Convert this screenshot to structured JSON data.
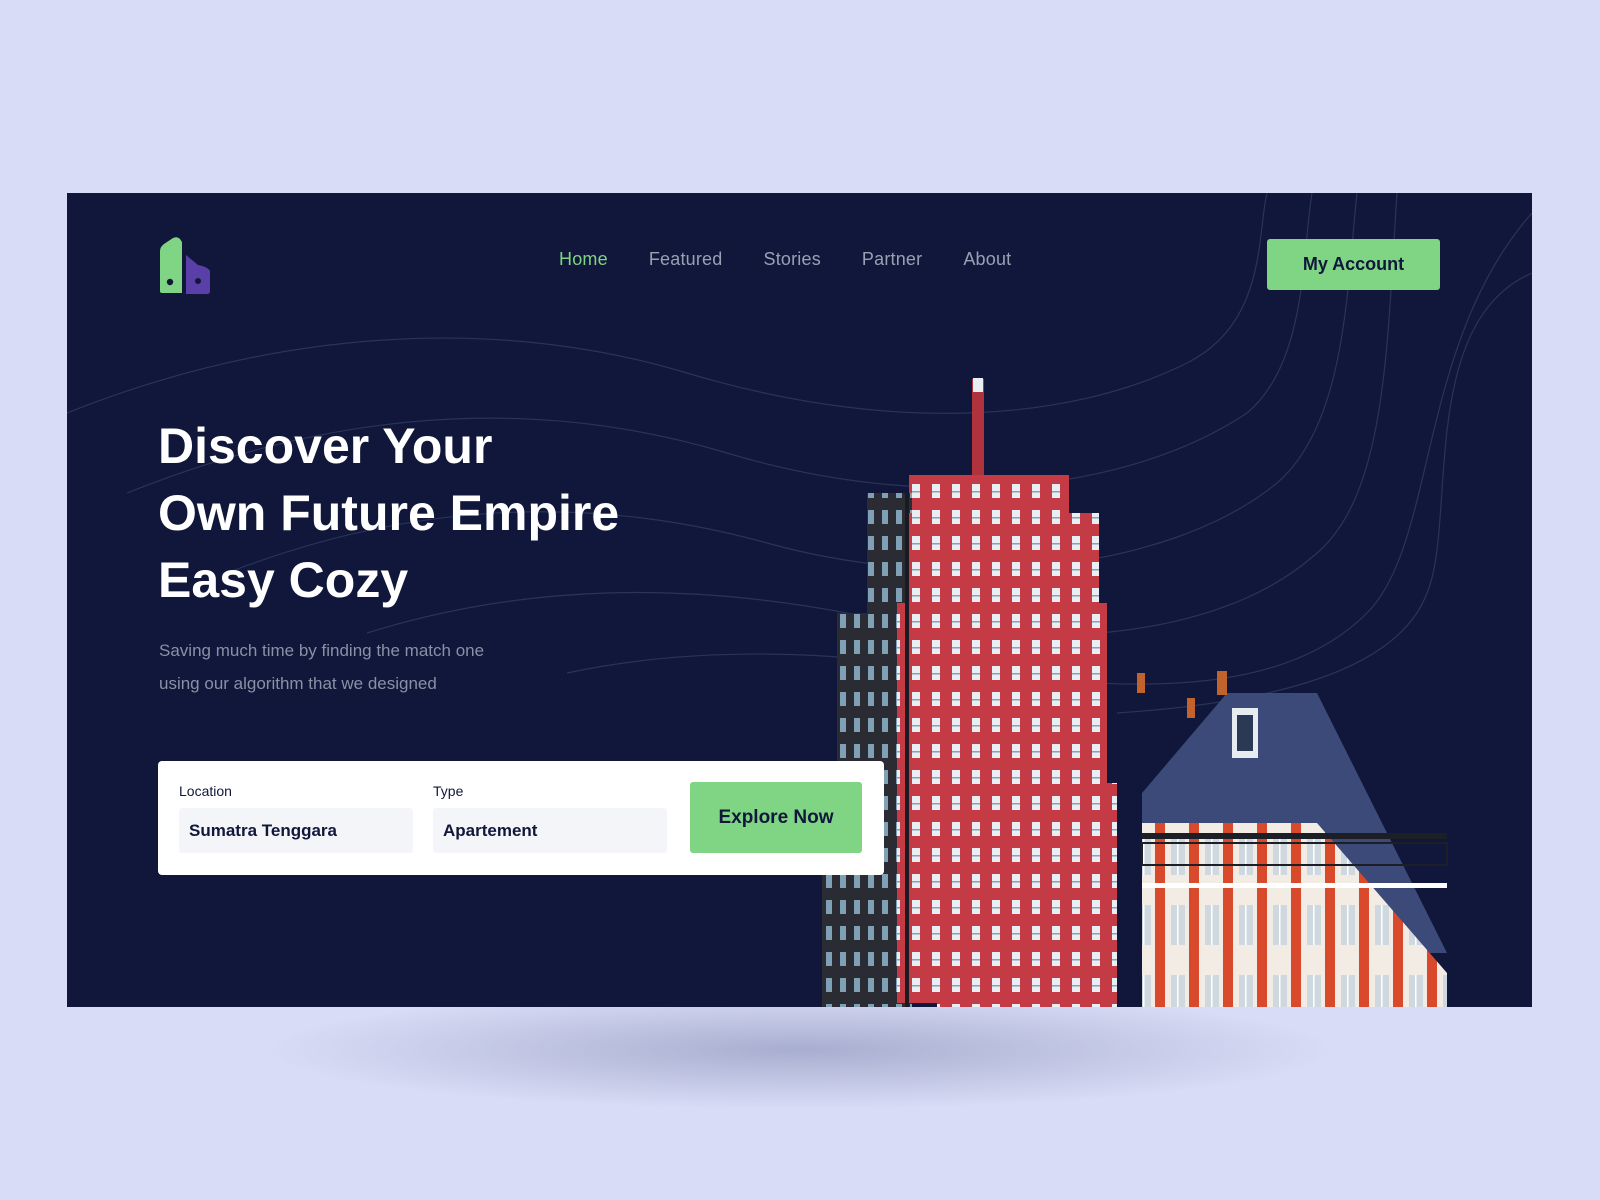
{
  "brand": {
    "logo_icon": "house-pair-logo-icon",
    "colors": {
      "green": "#7fd583",
      "purple": "#5b3fa8",
      "navy": "#10173a"
    }
  },
  "nav": {
    "items": [
      {
        "label": "Home",
        "active": true
      },
      {
        "label": "Featured",
        "active": false
      },
      {
        "label": "Stories",
        "active": false
      },
      {
        "label": "Partner",
        "active": false
      },
      {
        "label": "About",
        "active": false
      }
    ],
    "account_label": "My Account"
  },
  "hero": {
    "headline": [
      "Discover Your",
      "Own Future Empire",
      "Easy Cozy"
    ],
    "subtitle": [
      "Saving much time by finding the match one",
      "using our algorithm that we designed"
    ]
  },
  "search": {
    "location": {
      "label": "Location",
      "value": "Sumatra Tenggara"
    },
    "type": {
      "label": "Type",
      "value": "Apartement"
    },
    "button_label": "Explore Now"
  }
}
